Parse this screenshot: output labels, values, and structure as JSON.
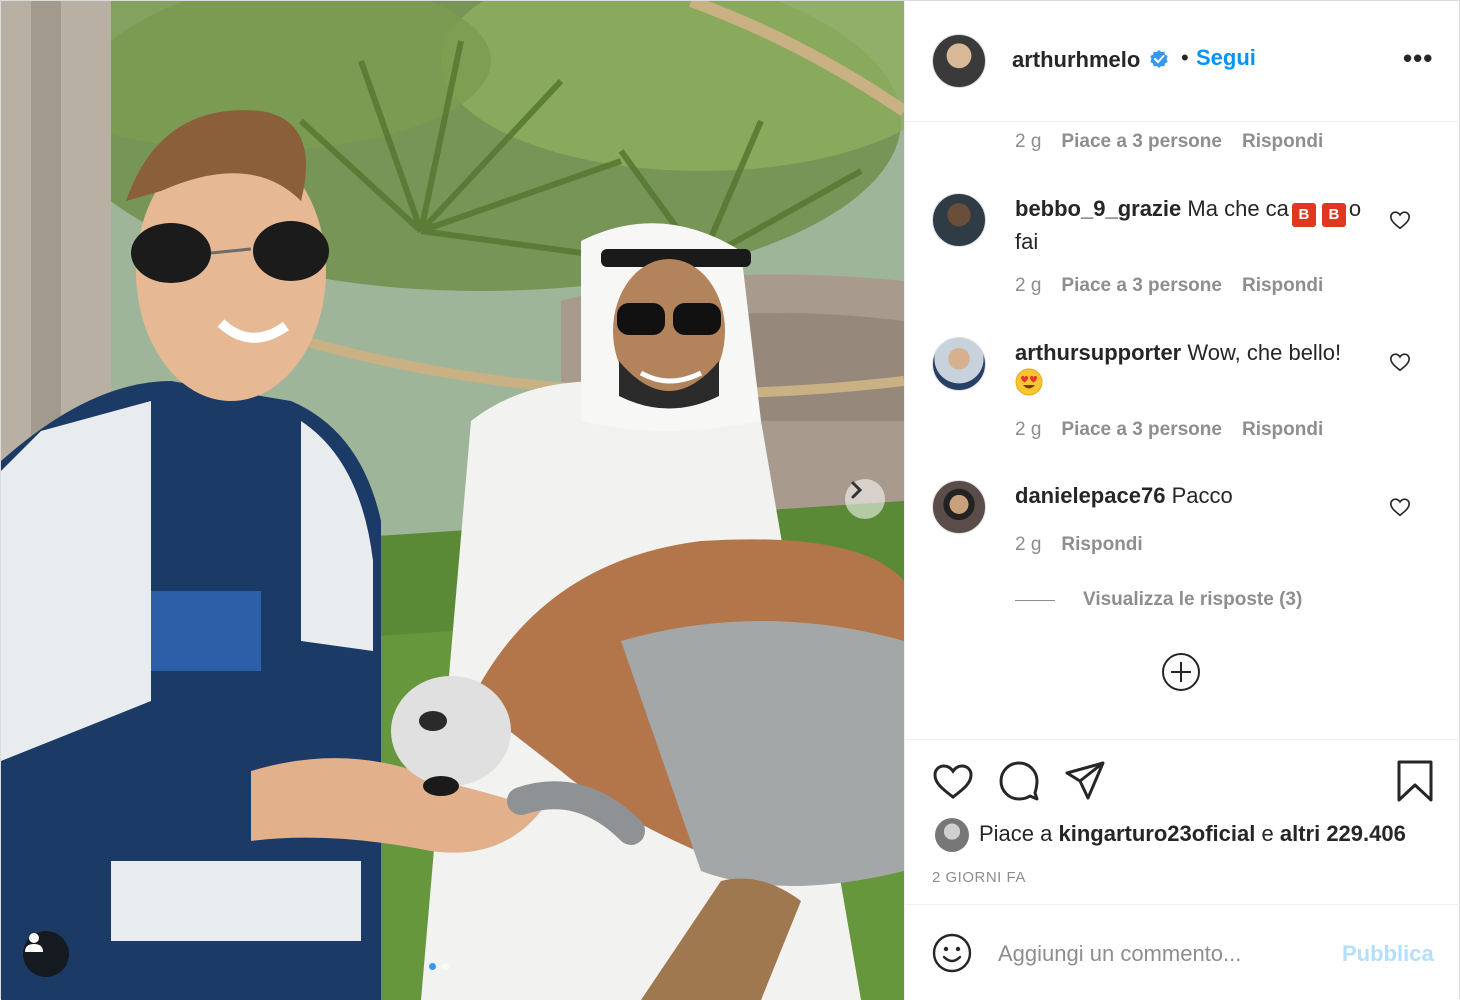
{
  "post": {
    "username": "arthurhmelo",
    "separator": "•",
    "follow_label": "Segui",
    "more_label": "•••"
  },
  "comments": {
    "top_meta": {
      "time": "2 g",
      "likes": "Piace a 3 persone",
      "reply": "Rispondi"
    },
    "items": [
      {
        "username": "bebbo_9_grazie",
        "text_start": "Ma che ca",
        "emoji_letter": "B",
        "text_mid": "",
        "text_end": "o fai",
        "time": "2 g",
        "likes": "Piace a 3 persone",
        "reply": "Rispondi"
      },
      {
        "username": "arthursupporter",
        "text": "Wow, che bello!",
        "emoji": "heart-eyes-emoji",
        "time": "2 g",
        "likes": "Piace a 3 persone",
        "reply": "Rispondi"
      },
      {
        "username": "danielepace76",
        "text": "Pacco",
        "time": "2 g",
        "reply": "Rispondi"
      }
    ],
    "view_replies": "Visualizza le risposte (3)"
  },
  "likes": {
    "prefix": "Piace a",
    "user": "kingarturo23oficial",
    "middle": "e",
    "count": "altri 229.406"
  },
  "date": "2 GIORNI FA",
  "composer": {
    "placeholder": "Aggiungi un commento...",
    "publish_label": "Pubblica"
  },
  "carousel": {
    "current_index": 1,
    "total": 2
  },
  "colors": {
    "link": "#0095f6",
    "muted": "#8e8e8e",
    "text": "#262626",
    "publish_disabled": "#b2dffc",
    "verified": "#3897f0"
  },
  "icons": [
    "verified-badge-icon",
    "heart-icon",
    "comment-icon",
    "share-icon",
    "bookmark-icon",
    "plus-circle-icon",
    "smile-icon",
    "chevron-right-icon",
    "user-tag-icon"
  ]
}
